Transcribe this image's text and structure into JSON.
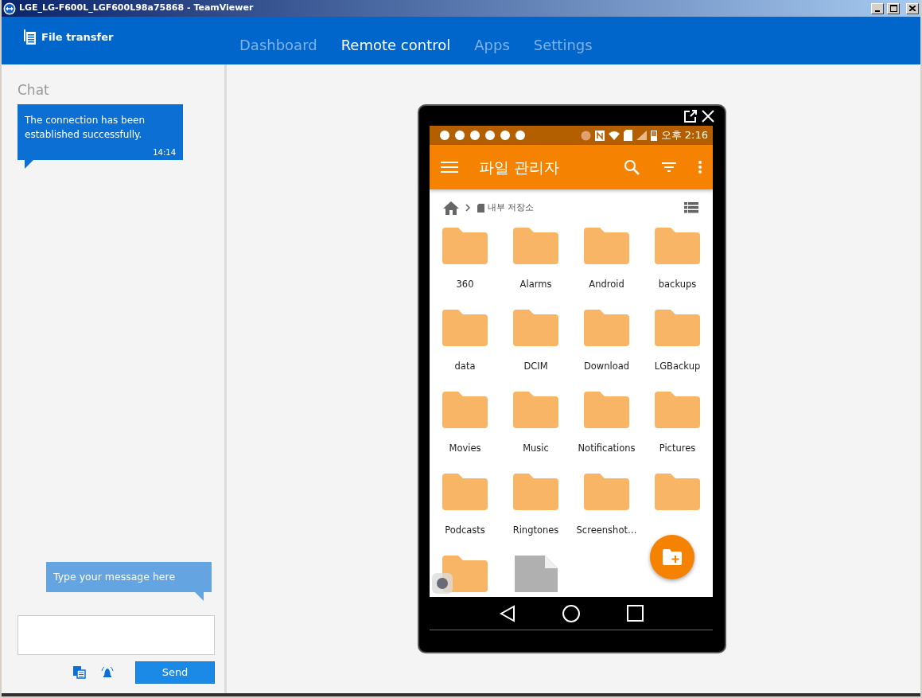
{
  "window": {
    "title": "LGE_LG-F600L_LGF600L98a75868 - TeamViewer"
  },
  "header": {
    "file_transfer": "File transfer",
    "tabs": [
      {
        "label": "Dashboard",
        "selected": false
      },
      {
        "label": "Remote control",
        "selected": true
      },
      {
        "label": "Apps",
        "selected": false
      },
      {
        "label": "Settings",
        "selected": false
      }
    ]
  },
  "chat": {
    "title": "Chat",
    "messages": [
      {
        "text": "The connection has been established successfully.",
        "time": "14:14"
      }
    ],
    "hint": "Type your message here",
    "send": "Send"
  },
  "phone": {
    "status_time": "오후 2:16",
    "app_title": "파일 관리자",
    "breadcrumb": "내부 저장소",
    "items": [
      {
        "kind": "folder",
        "name": "360"
      },
      {
        "kind": "folder",
        "name": "Alarms"
      },
      {
        "kind": "folder",
        "name": "Android"
      },
      {
        "kind": "folder",
        "name": "backups"
      },
      {
        "kind": "folder",
        "name": "data"
      },
      {
        "kind": "folder",
        "name": "DCIM"
      },
      {
        "kind": "folder",
        "name": "Download"
      },
      {
        "kind": "folder",
        "name": "LGBackup"
      },
      {
        "kind": "folder",
        "name": "Movies"
      },
      {
        "kind": "folder",
        "name": "Music"
      },
      {
        "kind": "folder",
        "name": "Notifications"
      },
      {
        "kind": "folder",
        "name": "Pictures"
      },
      {
        "kind": "folder",
        "name": "Podcasts"
      },
      {
        "kind": "folder",
        "name": "Ringtones"
      },
      {
        "kind": "folder",
        "name": "Screenshot…"
      },
      {
        "kind": "folder"
      },
      {
        "kind": "folder"
      },
      {
        "kind": "file"
      }
    ]
  }
}
